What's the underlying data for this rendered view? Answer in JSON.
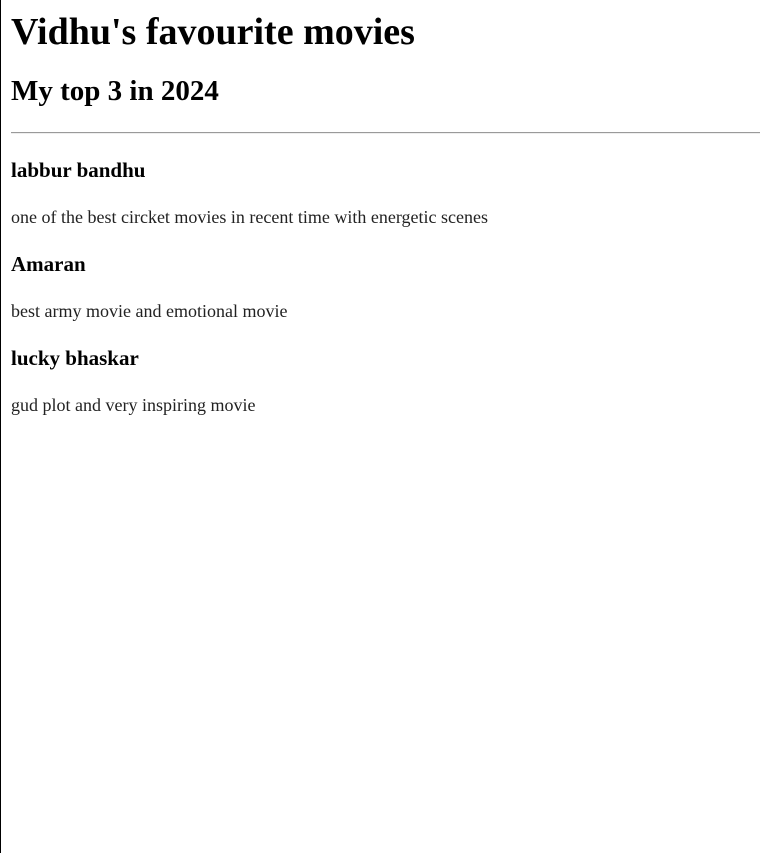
{
  "page": {
    "title": "Vidhu's favourite movies",
    "subtitle": "My top 3 in 2024"
  },
  "movies": [
    {
      "title": "labbur bandhu",
      "description": "one of the best circket movies in recent time with energetic scenes"
    },
    {
      "title": "Amaran",
      "description": "best army movie and emotional movie"
    },
    {
      "title": "lucky bhaskar",
      "description": "gud plot and very inspiring movie"
    }
  ]
}
